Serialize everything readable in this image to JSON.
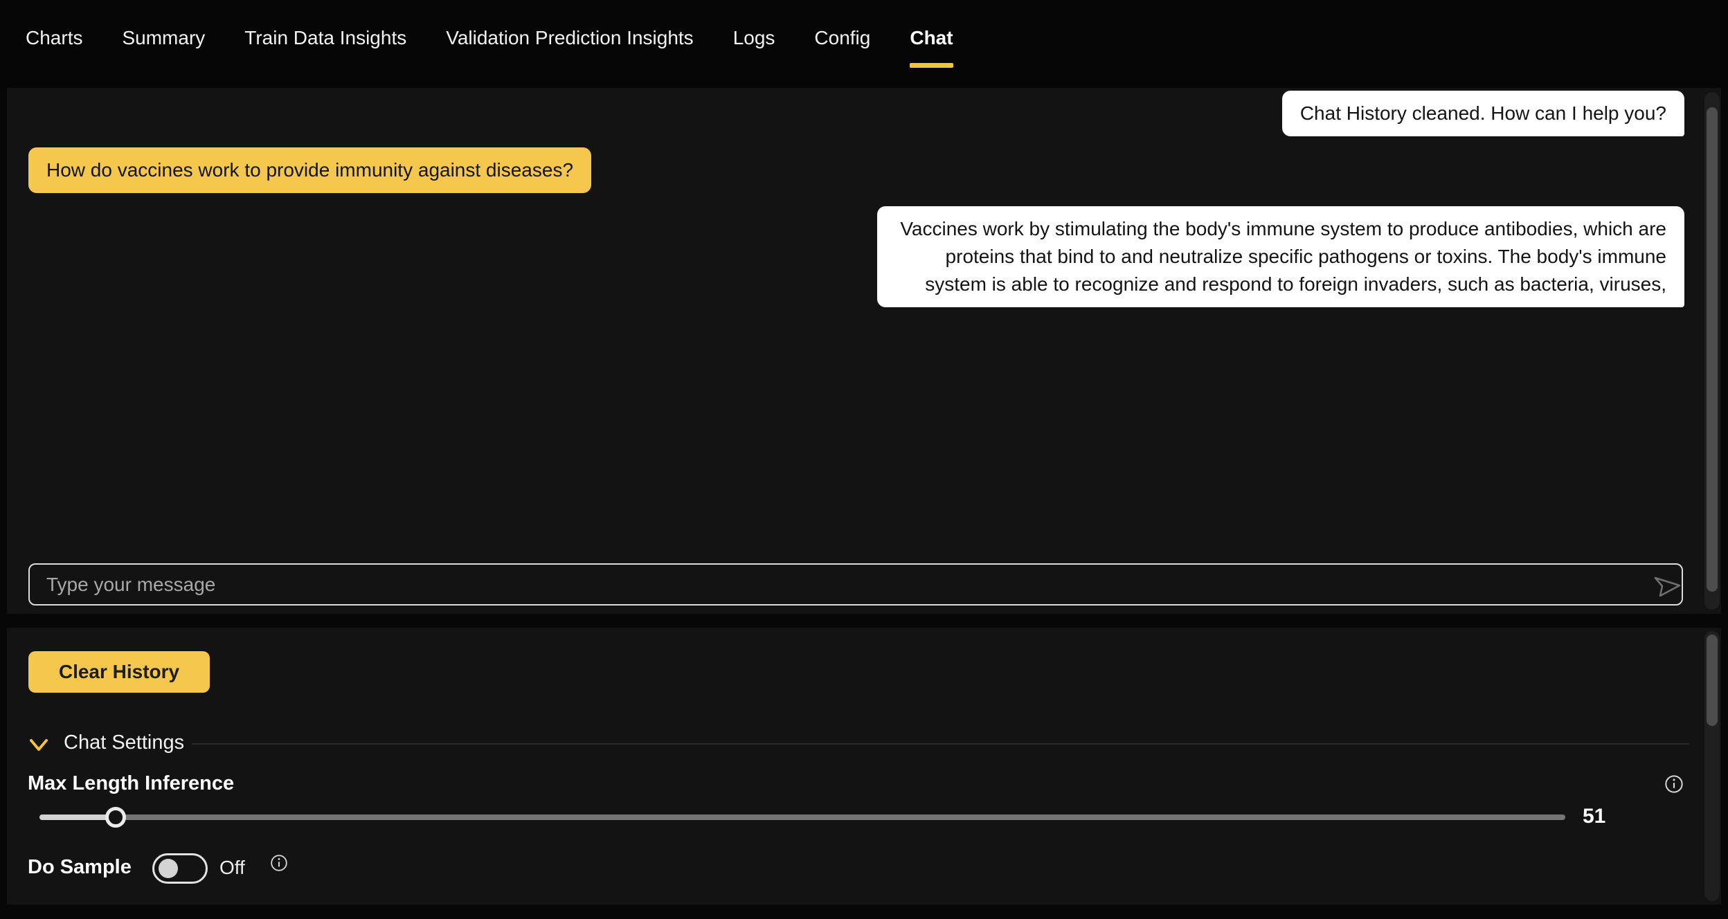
{
  "nav": {
    "tabs": [
      {
        "label": "Charts",
        "active": false
      },
      {
        "label": "Summary",
        "active": false
      },
      {
        "label": "Train Data Insights",
        "active": false
      },
      {
        "label": "Validation Prediction Insights",
        "active": false
      },
      {
        "label": "Logs",
        "active": false
      },
      {
        "label": "Config",
        "active": false
      },
      {
        "label": "Chat",
        "active": true
      }
    ]
  },
  "chat": {
    "messages": [
      {
        "role": "bot",
        "text": "Chat History cleaned. How can I help you?"
      },
      {
        "role": "user",
        "text": "How do vaccines work to provide immunity against diseases?"
      },
      {
        "role": "bot",
        "text": "Vaccines work by stimulating the body's immune system to produce antibodies, which are proteins that bind to and neutralize specific pathogens or toxins. The body's immune system is able to recognize and respond to foreign invaders, such as bacteria, viruses,"
      }
    ],
    "input_placeholder": "Type your message",
    "send_icon": "paper-plane-icon"
  },
  "settings": {
    "clear_history_label": "Clear History",
    "section_title": "Chat Settings",
    "max_length": {
      "label": "Max Length Inference",
      "value": "51",
      "info_icon": "info-icon"
    },
    "do_sample": {
      "label": "Do Sample",
      "state": "Off",
      "info_icon": "info-icon"
    }
  },
  "colors": {
    "accent_yellow": "#f5c74d",
    "tab_underline": "#f0c341",
    "panel_bg": "#131313",
    "page_bg": "#070707",
    "bubble_bot": "#ffffff",
    "bubble_user": "#f5c74d"
  }
}
